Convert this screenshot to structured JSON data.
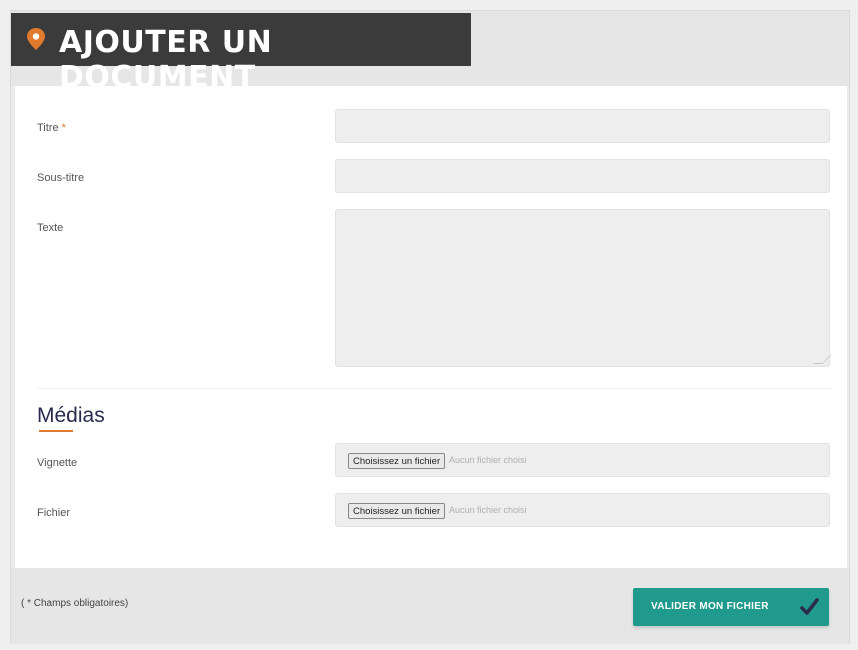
{
  "header": {
    "title": "AJOUTER UN DOCUMENT"
  },
  "form": {
    "titre_label": "Titre",
    "required_mark": "*",
    "sous_titre_label": "Sous-titre",
    "texte_label": "Texte",
    "medias_title": "Médias",
    "vignette_label": "Vignette",
    "fichier_label": "Fichier",
    "file_button_label": "Choisissez un fichier",
    "file_none_text": "Aucun fichier choisi"
  },
  "footer": {
    "required_note": "( * Champs obligatoires)",
    "submit_label": "VALIDER MON FICHIER"
  },
  "colors": {
    "accent_orange": "#e07b2e",
    "teal": "#1f9a8c",
    "dark": "#3b3b3b"
  }
}
